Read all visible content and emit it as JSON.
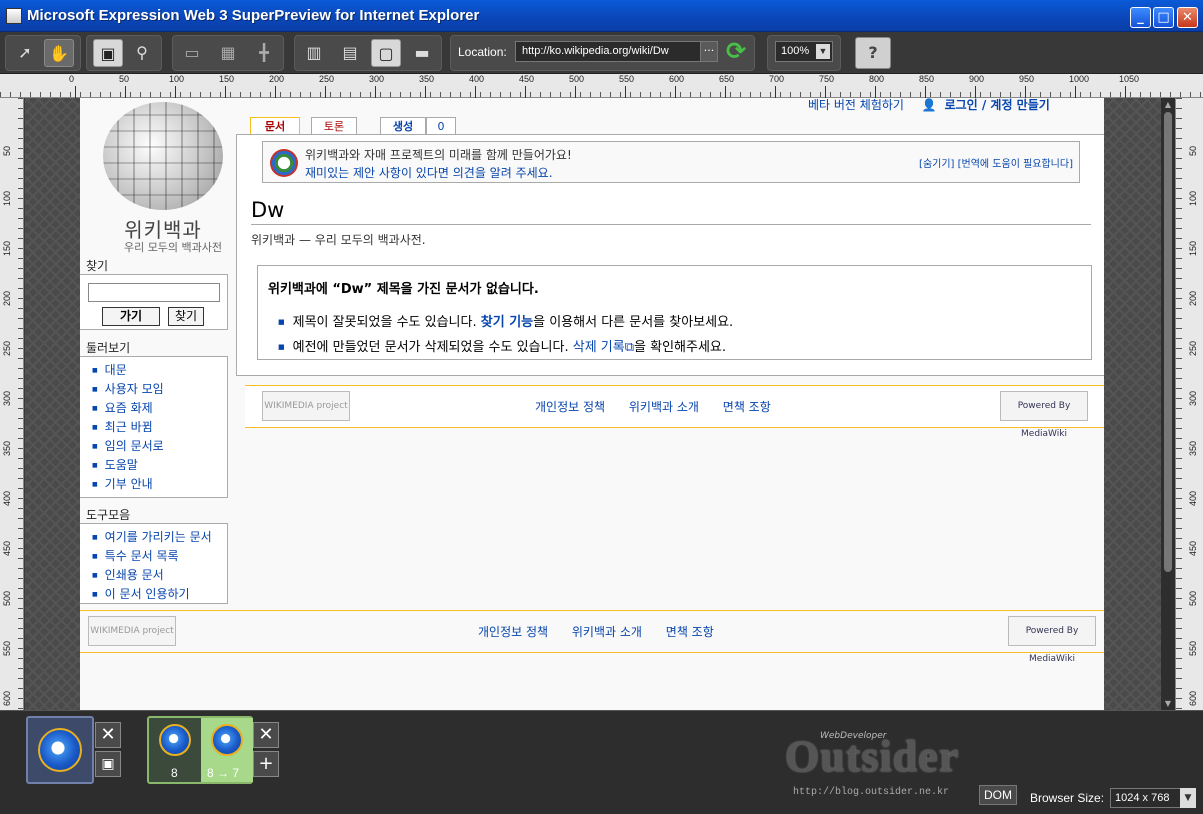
{
  "window": {
    "title": "Microsoft Expression Web 3 SuperPreview for Internet Explorer"
  },
  "toolbar": {
    "location_label": "Location:",
    "location_value": "http://ko.wikipedia.org/wiki/Dw",
    "more_label": "···",
    "zoom_value": "100%",
    "help_label": "?"
  },
  "ruler": {
    "h_ticks": [
      "0",
      "50",
      "100",
      "150",
      "200",
      "250",
      "300",
      "350",
      "400",
      "450",
      "500",
      "550",
      "600",
      "650",
      "700",
      "750",
      "800",
      "850",
      "900",
      "950",
      "1000",
      "1050"
    ],
    "v_ticks": [
      "50",
      "100",
      "150",
      "200",
      "250",
      "300",
      "350",
      "400",
      "450",
      "500",
      "550",
      "600"
    ]
  },
  "wiki": {
    "logo_name": "위키백과",
    "logo_sub": "우리 모두의 백과사전",
    "top_links": {
      "beta": "베타 버전 체험하기",
      "login": "로그인 / 계정 만들기"
    },
    "tabs": {
      "article": "문서",
      "talk": "토론",
      "create": "생성",
      "count": "0"
    },
    "notice": {
      "line1": "위키백과와 자매 프로젝트의 미래를 함께 만들어가요!",
      "line2": "재미있는 제안 사항이 있다면 의견을 알려 주세요.",
      "right": "[숨기기] [번역에 도움이 필요합니다]"
    },
    "page_title": "Dw",
    "tagline": "위키백과 — 우리 모두의 백과사전.",
    "noarticle": {
      "heading": "위키백과에 “Dw” 제목을 가진 문서가 없습니다.",
      "item1_pre": "제목이 잘못되었을 수도 있습니다.",
      "item1_link": "찾기 기능",
      "item1_post": "을 이용해서 다른 문서를 찾아보세요.",
      "item2_pre": "예전에 만들었던 문서가 삭제되었을 수도 있습니다.",
      "item2_link": "삭제 기록",
      "item2_post": "을 확인해주세요."
    },
    "footer": {
      "privacy": "개인정보 정책",
      "about": "위키백과 소개",
      "disclaimer": "면책 조항",
      "wikimedia": "WIKIMEDIA project",
      "mediawiki": "Powered By MediaWiki"
    },
    "search": {
      "title": "찾기",
      "go": "가기",
      "search": "찾기"
    },
    "nav": {
      "title": "둘러보기",
      "items": [
        "대문",
        "사용자 모임",
        "요즘 화제",
        "최근 바뀜",
        "임의 문서로",
        "도움말",
        "기부 안내"
      ]
    },
    "tools": {
      "title": "도구모음",
      "items": [
        "여기를 가리키는 문서",
        "특수 문서 목록",
        "인쇄용 문서",
        "이 문서 인용하기"
      ]
    }
  },
  "bottom": {
    "baseline_version": "8",
    "compare_version": "8",
    "compare_target": "8 → 7",
    "watermark": "Outsider",
    "watermark_top": "WebDeveloper",
    "watermark_url": "http://blog.outsider.ne.kr",
    "dom_label": "DOM",
    "size_label": "Browser Size:",
    "size_value": "1024 x 768"
  }
}
